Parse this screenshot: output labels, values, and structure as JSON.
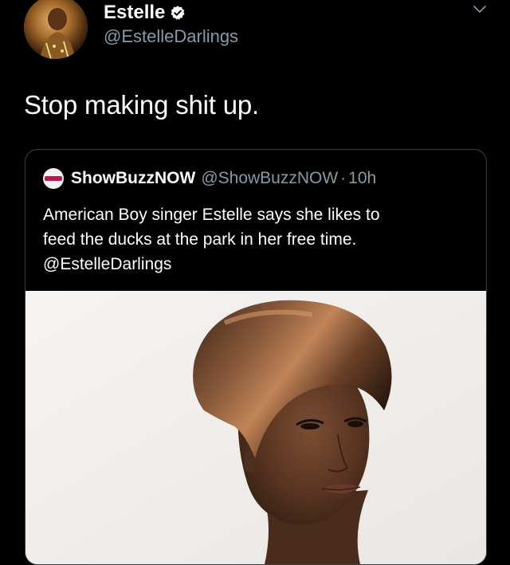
{
  "tweet": {
    "author_name": "Estelle",
    "author_handle": "@EstelleDarlings",
    "text": "Stop making shit up."
  },
  "quoted_tweet": {
    "author_name": "ShowBuzzNOW",
    "author_handle": "@ShowBuzzNOW",
    "separator": "·",
    "time": "10h",
    "text_lines": [
      "American Boy singer Estelle says she likes to",
      "feed the ducks at the park in her free time.",
      "@EstelleDarlings"
    ]
  },
  "icons": {
    "verified": "verified-badge-icon",
    "menu": "chevron-down-icon"
  },
  "colors": {
    "background": "#000000",
    "primary_text": "#ffffff",
    "secondary_text": "#8b98a5",
    "card_border": "#3a3f44",
    "verified_badge": "#ffffff"
  }
}
